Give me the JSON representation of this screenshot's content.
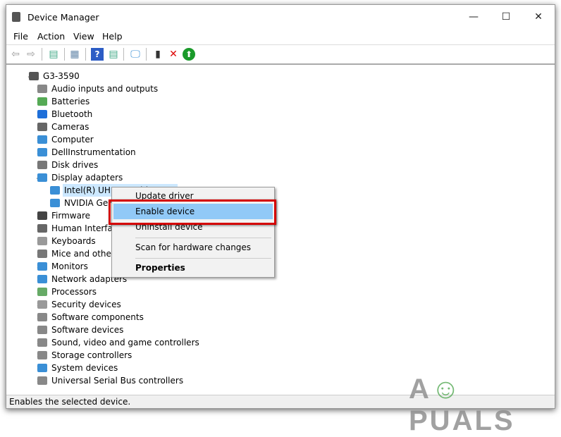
{
  "window": {
    "title": "Device Manager",
    "minimize": "—",
    "maximize": "☐",
    "close": "✕"
  },
  "menu": [
    "File",
    "Action",
    "View",
    "Help"
  ],
  "toolbar": [
    "back-icon",
    "forward-icon",
    "show-hide-console-tree-icon",
    "properties-icon",
    "help-icon",
    "action-pane-icon",
    "scan-hardware-icon",
    "update-driver-icon",
    "uninstall-icon",
    "enable-icon"
  ],
  "tree": {
    "root": "G3-3590",
    "categories": [
      {
        "label": "Audio inputs and outputs",
        "color": "#888"
      },
      {
        "label": "Batteries",
        "color": "#5a5"
      },
      {
        "label": "Bluetooth",
        "color": "#1e6fd9"
      },
      {
        "label": "Cameras",
        "color": "#666"
      },
      {
        "label": "Computer",
        "color": "#3a8fd6"
      },
      {
        "label": "DellInstrumentation",
        "color": "#3a8fd6"
      },
      {
        "label": "Disk drives",
        "color": "#777"
      },
      {
        "label": "Display adapters",
        "color": "#3a8fd6",
        "expanded": true,
        "children": [
          {
            "label": "Intel(R) UHD Graphics 630",
            "selected": true
          },
          {
            "label": "NVIDIA GeForce"
          }
        ]
      },
      {
        "label": "Firmware",
        "color": "#444"
      },
      {
        "label": "Human Interface Devices",
        "color": "#666"
      },
      {
        "label": "Keyboards",
        "color": "#999"
      },
      {
        "label": "Mice and other pointing devices",
        "color": "#777"
      },
      {
        "label": "Monitors",
        "color": "#3a8fd6"
      },
      {
        "label": "Network adapters",
        "color": "#3a8fd6"
      },
      {
        "label": "Processors",
        "color": "#6a6"
      },
      {
        "label": "Security devices",
        "color": "#999"
      },
      {
        "label": "Software components",
        "color": "#888"
      },
      {
        "label": "Software devices",
        "color": "#888"
      },
      {
        "label": "Sound, video and game controllers",
        "color": "#888"
      },
      {
        "label": "Storage controllers",
        "color": "#888"
      },
      {
        "label": "System devices",
        "color": "#3a8fd6"
      },
      {
        "label": "Universal Serial Bus controllers",
        "color": "#888"
      }
    ]
  },
  "context_menu": {
    "update": "Update driver",
    "enable": "Enable device",
    "uninstall": "Uninstall device",
    "scan": "Scan for hardware changes",
    "properties": "Properties"
  },
  "status": "Enables the selected device.",
  "watermark": "APPUALS"
}
